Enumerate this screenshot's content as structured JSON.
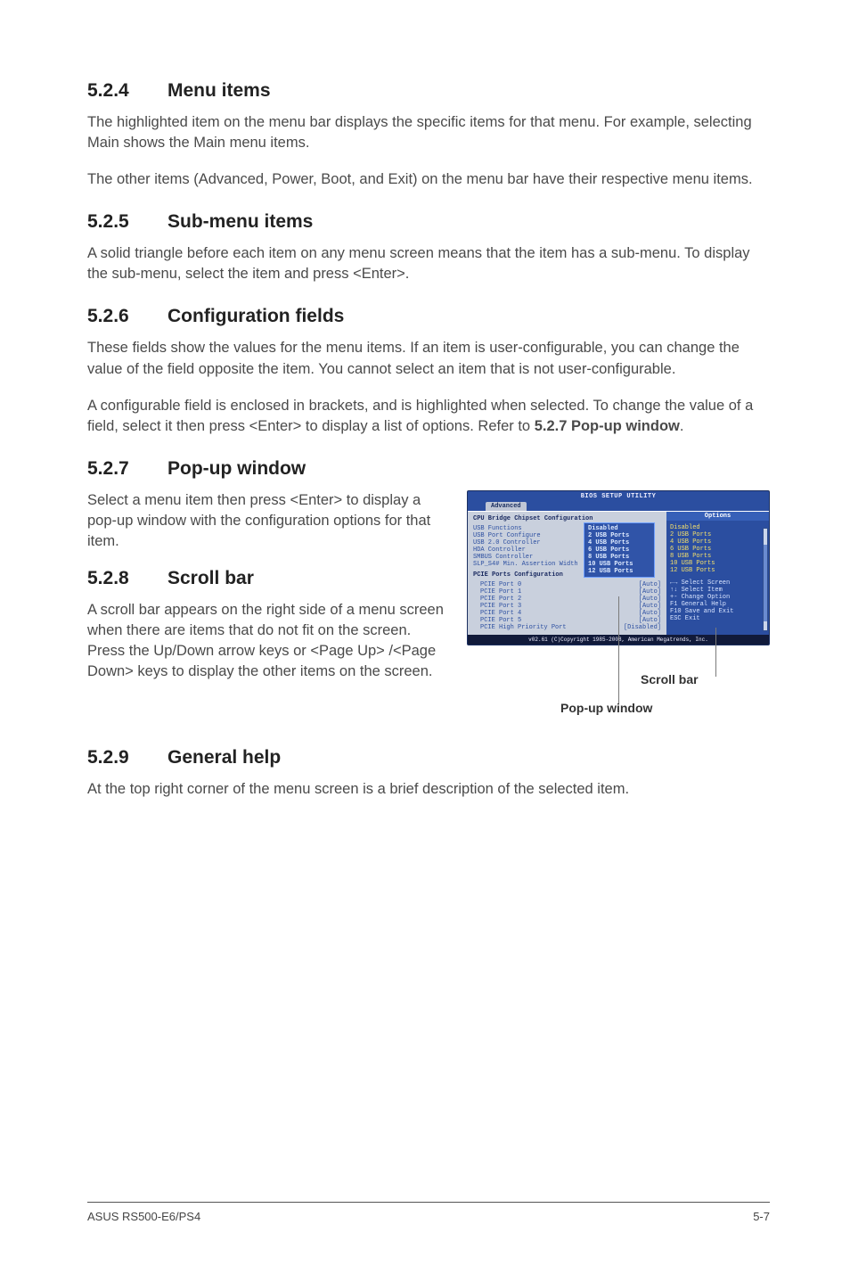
{
  "s524": {
    "num": "5.2.4",
    "title": "Menu items",
    "p1": "The highlighted item on the menu bar  displays the specific items for that menu. For example, selecting Main shows the Main menu items.",
    "p2": "The other items (Advanced, Power, Boot, and Exit) on the menu bar have their respective menu items."
  },
  "s525": {
    "num": "5.2.5",
    "title": "Sub-menu items",
    "p1": "A solid triangle before each item on any menu screen means that the item has a sub-menu. To display the sub-menu, select the item and press <Enter>."
  },
  "s526": {
    "num": "5.2.6",
    "title": "Configuration fields",
    "p1": "These fields show the values for the menu items. If an item is user-configurable, you can change the value of the field opposite the item. You cannot select an item that is not user-configurable.",
    "p2a": "A configurable field is enclosed in brackets, and is highlighted when selected. To change the value of a field, select it then press <Enter> to display a list of options. Refer to ",
    "p2b": "5.2.7 Pop-up window",
    "p2c": "."
  },
  "s527": {
    "num": "5.2.7",
    "title": "Pop-up window",
    "p1": "Select a menu item then press <Enter> to display a pop-up window with the configuration options for that item."
  },
  "s528": {
    "num": "5.2.8",
    "title": "Scroll bar",
    "p1": "A scroll bar appears on the right side of a menu screen when there are items that do not fit on the screen. Press the Up/Down arrow keys or <Page Up> /<Page Down> keys to display the other items on the screen."
  },
  "s529": {
    "num": "5.2.9",
    "title": "General help",
    "p1": "At the top right corner of the menu screen is a brief description of the selected item."
  },
  "bios": {
    "title": "BIOS SETUP UTILITY",
    "tab": "Advanced",
    "panel_title": "CPU Bridge Chipset Configuration",
    "left_rows": [
      {
        "lbl": "USB Functions",
        "val": ""
      },
      {
        "lbl": "USB Port Configure",
        "val": ""
      },
      {
        "lbl": "USB 2.0 Controller",
        "val": ""
      },
      {
        "lbl": "HDA Controller",
        "val": ""
      },
      {
        "lbl": "SMBUS Controller",
        "val": ""
      },
      {
        "lbl": "",
        "val": ""
      },
      {
        "lbl": "SLP_S4# Min. Assertion Width",
        "val": ""
      }
    ],
    "pcie_header": "PCIE Ports Configuration",
    "pcie_rows": [
      {
        "lbl": "PCIE Port 0",
        "val": "[Auto]"
      },
      {
        "lbl": "PCIE Port 1",
        "val": "[Auto]"
      },
      {
        "lbl": "PCIE Port 2",
        "val": "[Auto]"
      },
      {
        "lbl": "PCIE Port 3",
        "val": "[Auto]"
      },
      {
        "lbl": "PCIE Port 4",
        "val": "[Auto]"
      },
      {
        "lbl": "PCIE Port 5",
        "val": "[Auto]"
      },
      {
        "lbl": "PCIE High Priority Port",
        "val": "[Disabled]"
      }
    ],
    "popup": [
      "Disabled",
      "2 USB Ports",
      "4 USB Ports",
      "6 USB Ports",
      "8 USB Ports",
      "10 USB Ports",
      "12 USB Ports"
    ],
    "right_title": "Options",
    "right_opts": [
      "Disabled",
      "2 USB Ports",
      "4 USB Ports",
      "6 USB Ports",
      "8 USB Ports",
      "10 USB Ports",
      "12 USB Ports"
    ],
    "right_help": [
      "←→   Select Screen",
      "↑↓   Select Item",
      "+-   Change Option",
      "F1   General Help",
      "F10  Save and Exit",
      "ESC  Exit"
    ],
    "footer": "v02.61 (C)Copyright 1985-2008, American Megatrends, Inc."
  },
  "callouts": {
    "scroll": "Scroll bar",
    "popup": "Pop-up window"
  },
  "footer": {
    "left": "ASUS RS500-E6/PS4",
    "right": "5-7"
  }
}
